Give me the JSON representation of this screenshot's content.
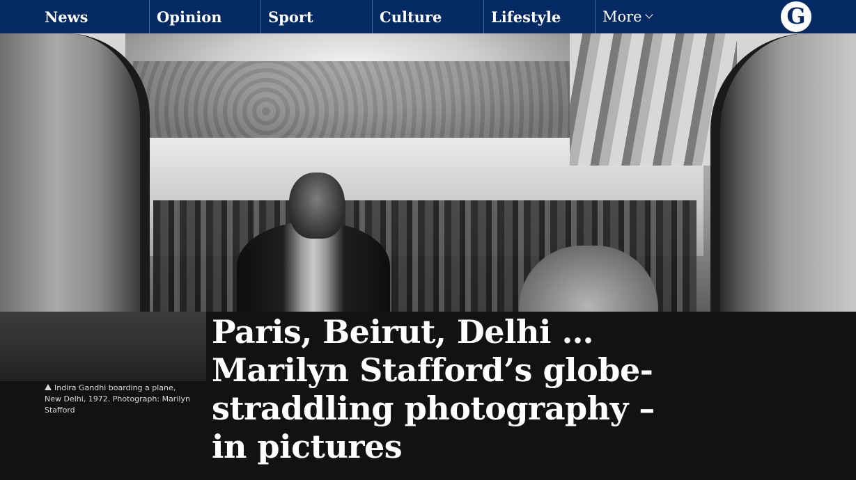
{
  "nav": {
    "items": [
      {
        "label": "News"
      },
      {
        "label": "Opinion"
      },
      {
        "label": "Sport"
      },
      {
        "label": "Culture"
      },
      {
        "label": "Lifestyle"
      }
    ],
    "more_label": "More",
    "logo_letter": "G",
    "background": "#052962"
  },
  "article": {
    "headline": "Paris, Beirut, Delhi … Marilyn Stafford’s globe-straddling photography – in pictures",
    "caption": "Indira Gandhi boarding a plane, New Delhi, 1972. Photograph: Marilyn Stafford"
  },
  "icons": [
    "guardian-logo-icon",
    "chevron-down-icon",
    "caption-triangle-icon"
  ]
}
